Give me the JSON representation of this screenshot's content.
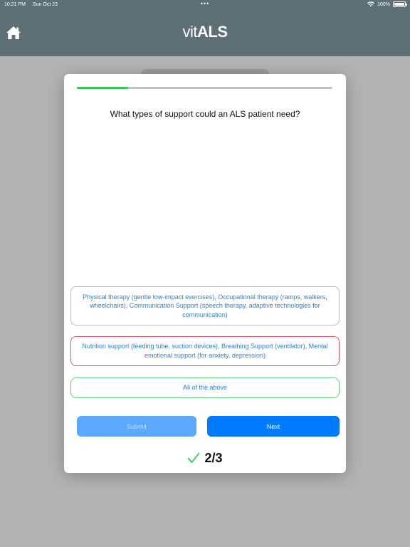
{
  "status_bar": {
    "time": "10:21 PM",
    "date": "Sun Oct 23",
    "battery": "100%"
  },
  "header": {
    "logo_part1": "vit",
    "logo_part2": "ALS"
  },
  "quiz": {
    "progress_fraction": 0.2,
    "question": "What types of support could an ALS patient need?",
    "options": [
      {
        "label": "Physical therapy (gentle low-impact exercises), Occupational therapy (ramps, walkers, wheelchairs), Communication Support (speech therapy, adaptive technologies for communication)",
        "state": "neutral"
      },
      {
        "label": "Nutrition support (feeding tube, suction devices), Breathing Support (ventilator), Mental emotional support (for anxiety, depression)",
        "state": "incorrect"
      },
      {
        "label": "All of the above",
        "state": "correct"
      }
    ],
    "submit_label": "Submit",
    "next_label": "Next",
    "score": "2/3"
  },
  "colors": {
    "header": "#5f7075",
    "progress": "#34c759",
    "accent": "#007aff",
    "incorrect": "#e05b5b",
    "correct": "#5fcf7a"
  }
}
